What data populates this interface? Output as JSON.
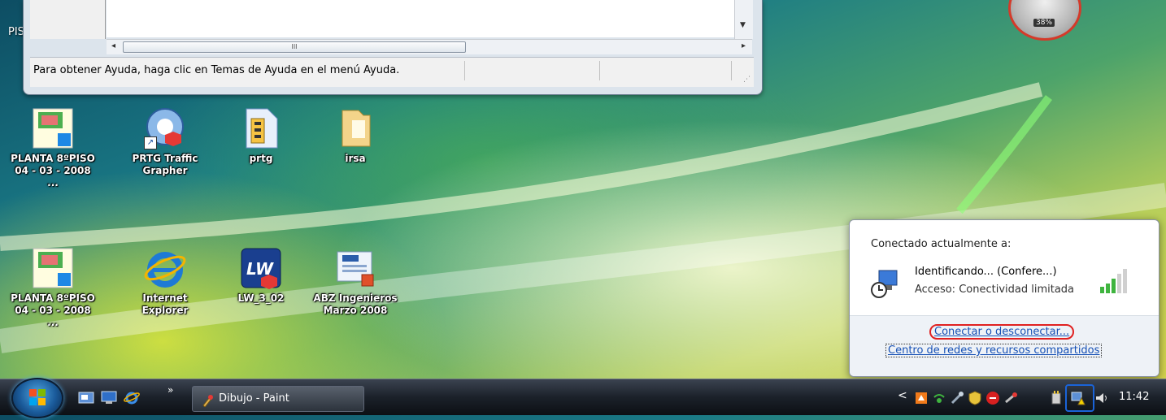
{
  "paint_window": {
    "status_text": "Para obtener Ayuda, haga clic en Temas de Ayuda en el menú Ayuda.",
    "thumb_grip": "III"
  },
  "desktop_partial_label": "PISC",
  "desktop_icons": [
    {
      "line1": "PLANTA 8ºPISO",
      "line2": "04 - 03 - 2008 ..."
    },
    {
      "line1": "PRTG Traffic",
      "line2": "Grapher"
    },
    {
      "line1": "prtg",
      "line2": ""
    },
    {
      "line1": "irsa",
      "line2": ""
    },
    {
      "line1": "PLANTA 8ºPISO",
      "line2": "04 - 03 - 2008 ..."
    },
    {
      "line1": "Internet Explorer",
      "line2": ""
    },
    {
      "line1": "LW_3_02",
      "line2": ""
    },
    {
      "line1": "ABZ Ingenieros",
      "line2": "Marzo 2008"
    }
  ],
  "gadget": {
    "percent": "38%"
  },
  "network_popup": {
    "header": "Conectado actualmente a:",
    "network_name": "Identificando... (Confere...)",
    "access": "Acceso: Conectividad limitada",
    "link_connect": "Conectar o desconectar...",
    "link_center": "Centro de redes y recursos compartidos"
  },
  "taskbar": {
    "task_button_label": "Dibujo - Paint",
    "more_glyph": "»",
    "tray_chevron": "<",
    "clock": "11:42"
  },
  "colors": {
    "link": "#1650b4",
    "highlight_ring": "#e02020",
    "tray_ring": "#1a63d8"
  }
}
